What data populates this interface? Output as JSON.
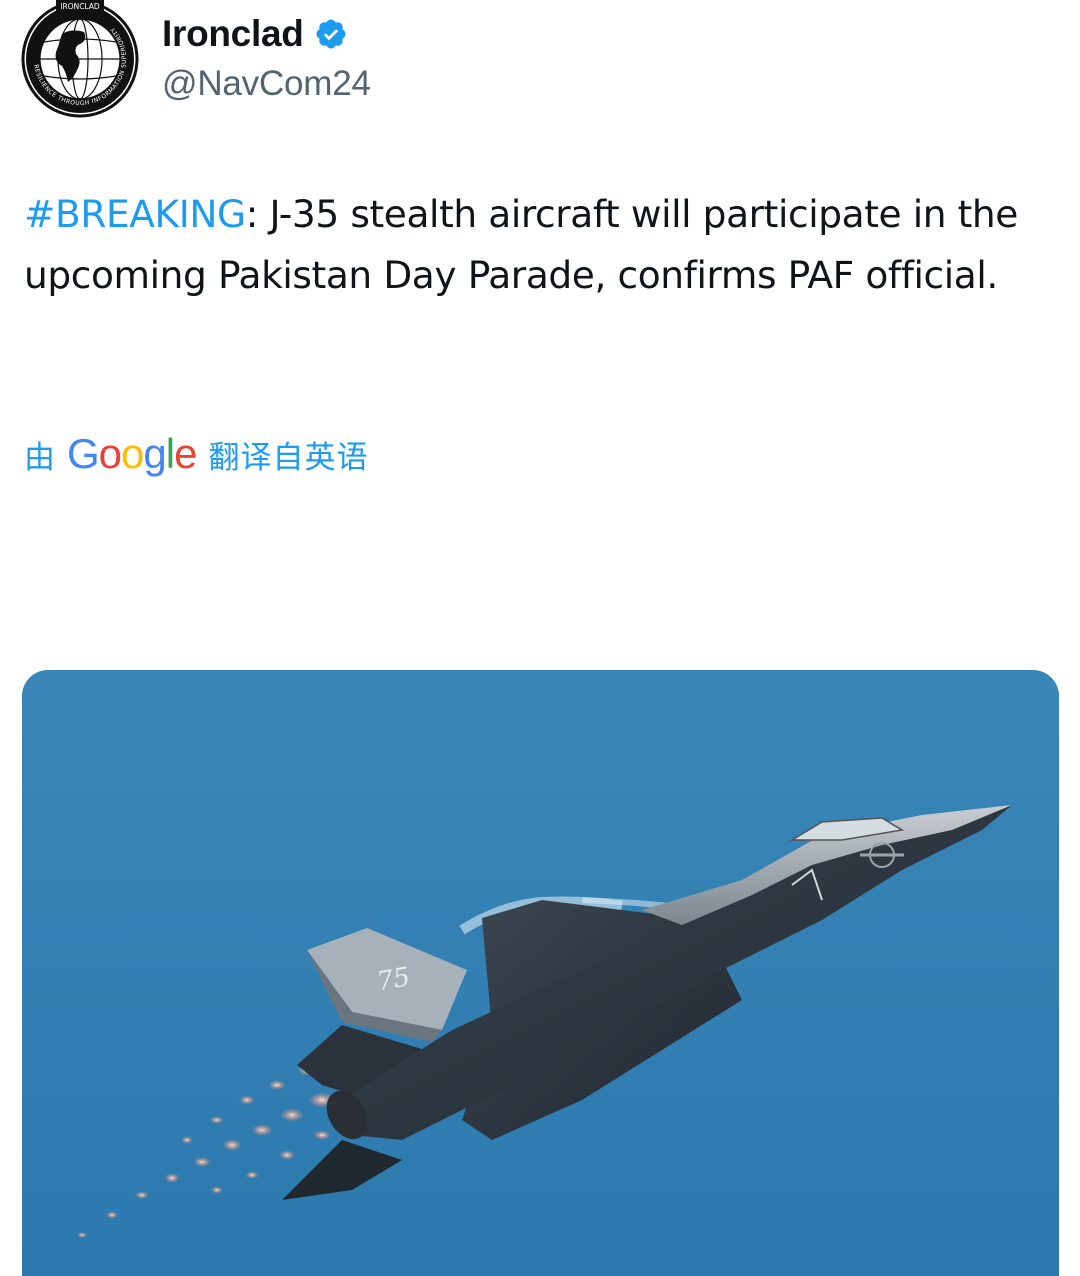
{
  "tweet": {
    "author": {
      "display_name": "Ironclad",
      "handle": "@NavCom24",
      "verified": true,
      "avatar_icon": "globe-emblem-icon",
      "avatar_top_text": "IRONCLAD",
      "avatar_ring_text": "RESILIENCE THROUGH INFORMATION SUPERIORITY"
    },
    "text": {
      "hashtag": "#BREAKING",
      "body": ": J-35 stealth aircraft will participate in the upcoming Pakistan Day Parade, confirms PAF official."
    },
    "translation": {
      "prefix": "由",
      "provider": "Google",
      "suffix": "翻译自英语"
    },
    "media": {
      "type": "photo",
      "tail_number": "75"
    }
  },
  "colors": {
    "link": "#1d9bf0",
    "text": "#0f1419",
    "secondary_text": "#536471",
    "sky": "#2e7cb0"
  }
}
